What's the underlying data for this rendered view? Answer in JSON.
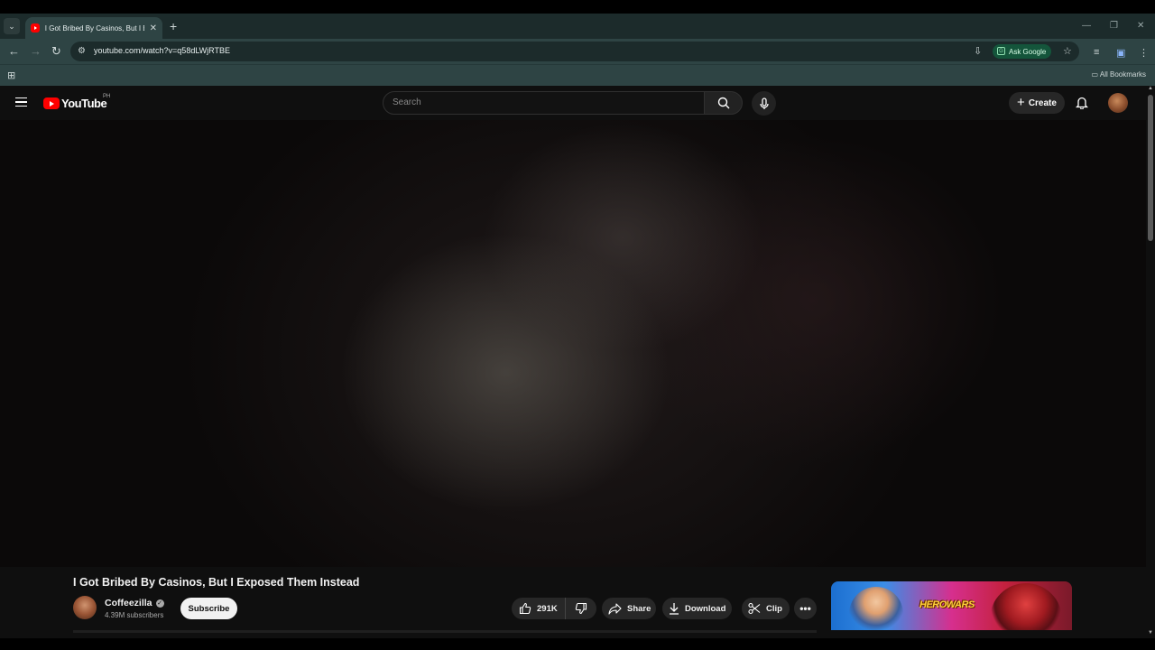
{
  "browser": {
    "tab": {
      "title": "I Got Bribed By Casinos, But I Ex",
      "favicon": "youtube-favicon-icon"
    },
    "url": "youtube.com/watch?v=q58dLWjRTBE",
    "ask_google_label": "Ask Google",
    "bookmarks_label": "All Bookmarks"
  },
  "youtube": {
    "logo_text": "YouTube",
    "country_code": "PH",
    "search_placeholder": "Search",
    "create_label": "Create",
    "video": {
      "title": "I Got Bribed By Casinos, But I Exposed Them Instead",
      "channel_name": "Coffeezilla",
      "subscribers": "4.39M subscribers",
      "subscribe_label": "Subscribe",
      "likes": "291K",
      "share_label": "Share",
      "download_label": "Download",
      "clip_label": "Clip"
    },
    "ad": {
      "logo_text": "HEROWARS"
    }
  },
  "colors": {
    "browser_frame": "#2e4444",
    "youtube_bg": "#0f0f0f",
    "youtube_red": "#ff0000",
    "ask_google_bg": "#14553b"
  }
}
